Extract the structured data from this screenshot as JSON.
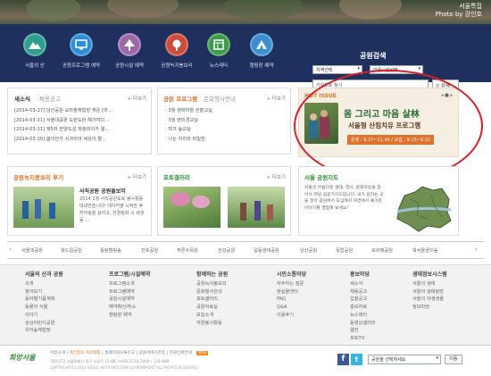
{
  "banner": {
    "title": "서울특집",
    "credit": "Photo by 강인호"
  },
  "nav": [
    {
      "label": "서울의 산",
      "color": "#2f9e8f",
      "icon": "mountain-icon"
    },
    {
      "label": "공원프로그램 예약",
      "color": "#2c8fd6",
      "icon": "monitor-icon"
    },
    {
      "label": "공원시설 예약",
      "color": "#9a6aa8",
      "icon": "tree-icon"
    },
    {
      "label": "공원녹지봉보리",
      "color": "#cf4b3b",
      "icon": "tree-icon"
    },
    {
      "label": "뉴스레터",
      "color": "#3e9b4d",
      "icon": "calendar-icon"
    },
    {
      "label": "캠핑장 예약",
      "color": "#3b8fcf",
      "icon": "tent-icon"
    }
  ],
  "search": {
    "title": "공원검색",
    "select_area": "지역선택",
    "select_facility": "이용시설선택",
    "keyword_placeholder": "키워드로 찾기",
    "button": "검색"
  },
  "news": {
    "tabs": [
      "새소식",
      "채용공고"
    ],
    "more": "+ 더보기",
    "items": [
      "[2014-03-17] 남산공원 요마솔체험장 재운 [마...",
      "[2014-03-11] 서울대공원 도란도란 해가여다...",
      "[2014-03-11] 제5차 한양도성 학술회의가 열...",
      "[2014-03-20] 봄이던가 시크리어 세상이 향..."
    ]
  },
  "programs": {
    "tabs": [
      "공원 프로그램",
      "문화행사안내"
    ],
    "more": "+ 더보기",
    "items": [
      "3월 생태마을 관찰교실",
      "3월 현미경교실",
      "피크 숲교실",
      "나는 이리의 파일찬"
    ]
  },
  "hot_issue": {
    "label": "HOT ISSUE",
    "headline": "몸 그리고 마음 살林",
    "subline": "서울형 산림치유 프로그램",
    "dates": "운영 : 9.27~11.30 / 모집 : 9.15~9.22"
  },
  "volunteer": {
    "title": "공원녹지봉보리 후기",
    "more": "+ 더보기",
    "post_title": "사직공원 공원돌보미",
    "post_text": "2014 1월 사직공원도로 봉사활동 대내한습니다! 데이커셀 시작한 후 히어링을 싫어고, 한경정화 시 세생동 ..."
  },
  "gallery": {
    "title": "포토갤러리",
    "more": "+ 더보기"
  },
  "map": {
    "title": "서울 공원지도",
    "text": "서울의 아름다운 생태, 역사, 문화자원을 찾아서 떠날 공원가이드입니다. 내가 원하는 곳을 찾아 공원에서 도심에서 자연에서 즐거운 이야기를 경험해 보세요!"
  },
  "park_strip": {
    "items": [
      "서울대공원",
      "월드컵공원",
      "중랑캠핑숲",
      "천호공원",
      "푸른수목원",
      "한강공원",
      "길동생태공원",
      "남산공원",
      "독립공원",
      "보라매공원",
      "북서울꿈의숲"
    ]
  },
  "footer": {
    "columns": [
      {
        "title": "서울의 산과 공원",
        "items": [
          "소개",
          "찾아보기",
          "동아별기품계획",
          "동물의 서울",
          "이야기",
          "상상어린이공원",
          "유아숲체험장"
        ]
      },
      {
        "title": "프로그램/시설예약",
        "items": [
          "프로그램소개",
          "프로그램예약",
          "공원시설예약",
          "예약확인/취소",
          "캠핑장 예약"
        ]
      },
      {
        "title": "함께하는 공원",
        "items": [
          "공원녹지봉보리",
          "문화행사안내",
          "포토갤러리",
          "공원자료실",
          "모집소개",
          "자원봉사활동"
        ]
      },
      {
        "title": "시민소통마당",
        "items": [
          "자주하는 질문",
          "분실물센터",
          "FAQ",
          "Q&A",
          "이용후기"
        ]
      },
      {
        "title": "홍보마당",
        "items": [
          "새소식",
          "채용공고",
          "입찰공고",
          "홍보자료",
          "뉴스레터",
          "동영상갤러리",
          "웹진",
          "포토TV"
        ]
      },
      {
        "title": "생태정보시스템",
        "items": [
          "서울의 생태",
          "서울의 생태탐방",
          "서울의 야생생물",
          "정보마당"
        ]
      }
    ]
  },
  "bottom": {
    "links": [
      "이용소개",
      "개인정보 처리방침",
      "홈페이지오류신고",
      "공원서비스헌장",
      "전자민원안내"
    ],
    "address": "100-272 서울특별시 중구 오류로 21-88 (사)02-2133-2064 / 121-088",
    "copyright": "COPYRIGHT(C) 2014 SEOUL METROPOLITAN GOVERNMENT ALL RIGHTS RESERVED.",
    "logo": "희망서울",
    "badge": "RSS",
    "select_park": "공원을 선택하세요",
    "go": "이동"
  },
  "colors": {
    "nav_bg": "#1f2f5e",
    "orange": "#e0722a",
    "highlight": "#d8202a"
  }
}
